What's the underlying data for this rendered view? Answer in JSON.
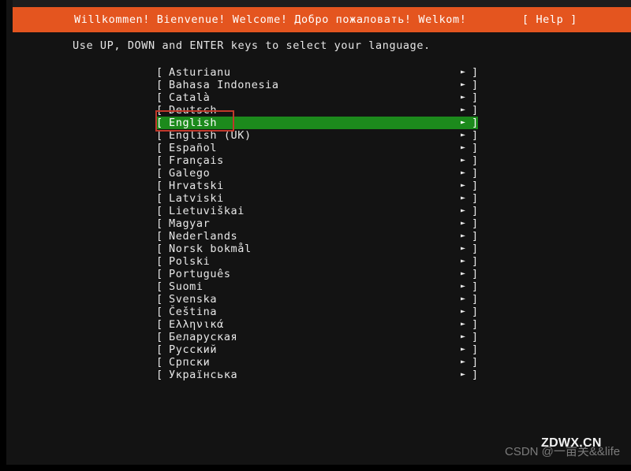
{
  "window": {
    "frame_color": "#000000",
    "background_color": "#131313"
  },
  "title_bar": {
    "background_color": "#e4551f",
    "text_color": "#ffffff",
    "greeting": "Willkommen! Bienvenue! Welcome! Добро пожаловать! Welkom!",
    "help_label": "[ Help ]"
  },
  "instruction": {
    "text": "Use UP, DOWN and ENTER keys to select your language."
  },
  "language_list": {
    "open_bracket": "[",
    "close_bracket": "]",
    "arrow_glyph": "►",
    "selected_index": 4,
    "selection_color": "#1c8a1c",
    "annotation_color": "#c0392b",
    "items": [
      {
        "label": "Asturianu"
      },
      {
        "label": "Bahasa Indonesia"
      },
      {
        "label": "Català"
      },
      {
        "label": "Deutsch"
      },
      {
        "label": "English"
      },
      {
        "label": "English (UK)"
      },
      {
        "label": "Español"
      },
      {
        "label": "Français"
      },
      {
        "label": "Galego"
      },
      {
        "label": "Hrvatski"
      },
      {
        "label": "Latviski"
      },
      {
        "label": "Lietuviškai"
      },
      {
        "label": "Magyar"
      },
      {
        "label": "Nederlands"
      },
      {
        "label": "Norsk bokmål"
      },
      {
        "label": "Polski"
      },
      {
        "label": "Português"
      },
      {
        "label": "Suomi"
      },
      {
        "label": "Svenska"
      },
      {
        "label": "Čeština"
      },
      {
        "label": "Ελληνικά"
      },
      {
        "label": "Беларуская"
      },
      {
        "label": "Русский"
      },
      {
        "label": "Српски"
      },
      {
        "label": "Українська"
      }
    ]
  },
  "watermarks": {
    "csdn": "CSDN @一亩关&&life",
    "zdwx": "ZDWX.CN"
  }
}
